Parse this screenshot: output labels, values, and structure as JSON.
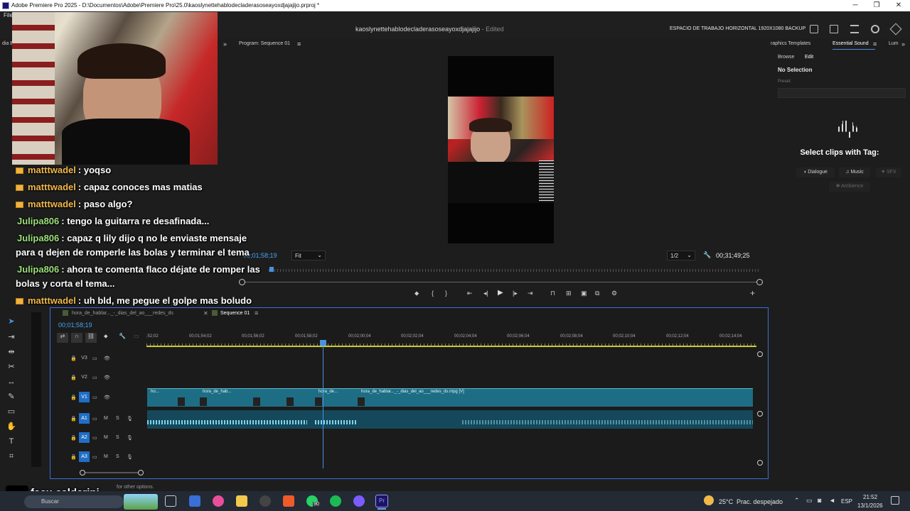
{
  "window": {
    "title": "Adobe Premiere Pro 2025 - D:\\Documentos\\Adobe\\Premiere Pro\\25.0\\kaoslynettehablodecladerasoseayoxdjajajijo.prproj *",
    "menu_file": "File",
    "minimize": "─",
    "maximize": "❐",
    "close": "✕"
  },
  "header": {
    "sequence_name": "kaoslynettehablodecladerasoseayoxdjajajijo",
    "edited_label": "- Edited",
    "workspace": "ESPACIO DE TRABAJO HORIZONTAL 1920X1080 BACKUP"
  },
  "left_panel": {
    "tab_label": "dia B"
  },
  "program": {
    "tab_label": "Program: Sequence 01",
    "timecode_current": "00;01;58;19",
    "fit_label": "Fit",
    "resolution": "1/2",
    "timecode_duration": "00;31;49;25"
  },
  "timeline": {
    "tabs": [
      "hora_de_hablar..._-_dias_del_ao___redes_ds",
      "Sequence 01"
    ],
    "timecode": "00;01;58;19",
    "ruler": [
      ";52;02",
      "00;01;54;02",
      "00;01;56;02",
      "00;01;58;02",
      "00;02;00;04",
      "00;02;02;04",
      "00;02;04;04",
      "00;02;06;04",
      "00;02;08;04",
      "00;02;10;04",
      "00;02;12;04",
      "00;02;14;04"
    ],
    "video_tracks": [
      "V3",
      "V2",
      "V1"
    ],
    "audio_tracks": [
      "A1",
      "A2",
      "A3"
    ],
    "mute_label": "M",
    "solo_label": "S",
    "clips": [
      "ho...",
      "hora_de_hab...",
      "hora_de...",
      "hora_de_hablar..._-_dias_del_ao___redes_ds.mpg [V]"
    ]
  },
  "essential_sound": {
    "tab_graphics": "raphics Templates",
    "tab_essential": "Essential Sound",
    "tab_lum": "Lum",
    "browse": "Browse",
    "edit": "Edit",
    "no_selection": "No Selection",
    "preset_label": "Preset:",
    "select_tag": "Select clips with Tag:",
    "tags": [
      "Dialogue",
      "Music",
      "SFX",
      "Ambience"
    ]
  },
  "chat": [
    {
      "user": "matttwadel",
      "message": ": yoqso",
      "color": "orange"
    },
    {
      "user": "matttwadel",
      "message": ": capaz conoces mas matias",
      "color": "orange"
    },
    {
      "user": "matttwadel",
      "message": ": paso algo?",
      "color": "orange"
    },
    {
      "user": "Julipa806",
      "message": ": tengo la guitarra re desafinada...",
      "color": "green"
    },
    {
      "user": "Julipa806",
      "message": ": capaz q lily dijo q no le enviaste mensaje",
      "color": "green"
    },
    {
      "continuation": "para q dejen de romperle las bolas y terminar el tema"
    },
    {
      "user": "Julipa806",
      "message": ": ahora te comenta flaco déjate de romper las",
      "color": "green"
    },
    {
      "continuation": "bolas y corta el tema..."
    },
    {
      "user": "matttwadel",
      "message": ": uh bld, me pegue el golpe mas boludo",
      "color": "orange"
    }
  ],
  "watermark": {
    "handle": "facu.calderini"
  },
  "status_bar": {
    "hint": "for other options."
  },
  "taskbar": {
    "search": "Buscar",
    "weather_temp": "25°C",
    "weather_desc": "Prac. despejado",
    "lang": "ESP",
    "time": "21:52",
    "date": "13/1/2026",
    "badge_count": "90"
  },
  "colors": {
    "timeline_border": "#3a6fd8",
    "clip_video": "#1d6e85",
    "clip_audio": "#15485a",
    "playhead": "#4a90e2",
    "track_active": "#1f6fc6"
  }
}
